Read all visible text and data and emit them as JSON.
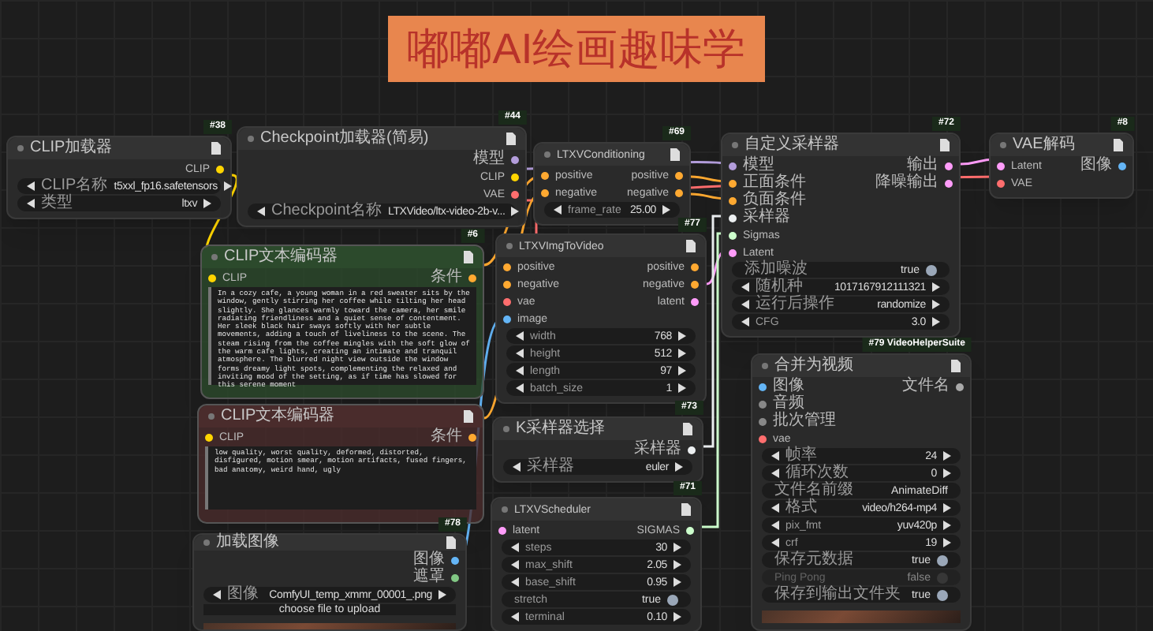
{
  "banner": {
    "title": "嘟嘟AI绘画趣味学"
  },
  "nodes": [
    {
      "badge": "#38",
      "title": "CLIP加载器",
      "outputs": [
        {
          "label": "CLIP",
          "color": "#ffd500"
        }
      ],
      "widgets": [
        {
          "kind": "combo",
          "label": "CLIP名称",
          "value": "t5xxl_fp16.safetensors"
        },
        {
          "kind": "combo",
          "label": "类型",
          "value": "ltxv"
        }
      ]
    },
    {
      "badge": "#44",
      "title": "Checkpoint加载器(简易)",
      "outputs": [
        {
          "label": "模型",
          "color": "#b39ddb"
        },
        {
          "label": "CLIP",
          "color": "#ffd500"
        },
        {
          "label": "VAE",
          "color": "#ff6e6e"
        }
      ],
      "widgets": [
        {
          "kind": "combo",
          "label": "Checkpoint名称",
          "value": "LTXVideo/ltx-video-2b-v..."
        }
      ]
    },
    {
      "badge": "#6",
      "title": "CLIP文本编码器",
      "color": "#2c4a2c",
      "inputs": [
        {
          "label": "CLIP",
          "color": "#ffd500"
        }
      ],
      "outputs": [
        {
          "label": "条件",
          "color": "#ffa931"
        }
      ],
      "widgets": [
        {
          "kind": "textarea",
          "value": "In a cozy cafe, a young woman in a red sweater sits by the window, gently stirring her coffee while tilting her head slightly. She glances warmly toward the camera, her smile radiating friendliness and a quiet sense of contentment. Her sleek black hair sways softly with her subtle movements, adding a touch of liveliness to the scene. The steam rising from the coffee mingles with the soft glow of the warm cafe lights, creating an intimate and tranquil atmosphere. The blurred night view outside the window forms dreamy light spots, complementing the relaxed and inviting mood of the setting, as if time has slowed for this serene moment"
        }
      ]
    },
    {
      "title": "CLIP文本编码器",
      "color": "#4a2c2c",
      "inputs": [
        {
          "label": "CLIP",
          "color": "#ffd500"
        }
      ],
      "outputs": [
        {
          "label": "条件",
          "color": "#ffa931"
        }
      ],
      "widgets": [
        {
          "kind": "textarea",
          "value": "low quality, worst quality, deformed, distorted, disfigured, motion smear, motion artifacts, fused fingers, bad anatomy, weird hand, ugly"
        }
      ]
    },
    {
      "badge": "#78",
      "title": "加载图像",
      "outputs": [
        {
          "label": "图像",
          "color": "#64b5f6"
        },
        {
          "label": "遮罩",
          "color": "#81c784"
        }
      ],
      "widgets": [
        {
          "kind": "combo",
          "label": "图像",
          "value": "ComfyUI_temp_xmmr_00001_.png"
        },
        {
          "kind": "button",
          "label": "choose file to upload"
        },
        {
          "kind": "image"
        }
      ]
    },
    {
      "badge": "#69",
      "title": "LTXVConditioning",
      "inputs": [
        {
          "label": "positive",
          "color": "#ffa931"
        },
        {
          "label": "negative",
          "color": "#ffa931"
        }
      ],
      "outputs": [
        {
          "label": "positive",
          "color": "#ffa931"
        },
        {
          "label": "negative",
          "color": "#ffa931"
        }
      ],
      "widgets": [
        {
          "kind": "number",
          "label": "frame_rate",
          "value": "25.00"
        }
      ]
    },
    {
      "badge": "#77",
      "title": "LTXVImgToVideo",
      "inputs": [
        {
          "label": "positive",
          "color": "#ffa931"
        },
        {
          "label": "negative",
          "color": "#ffa931"
        },
        {
          "label": "vae",
          "color": "#ff6e6e"
        },
        {
          "label": "image",
          "color": "#64b5f6"
        }
      ],
      "outputs": [
        {
          "label": "positive",
          "color": "#ffa931"
        },
        {
          "label": "negative",
          "color": "#ffa931"
        },
        {
          "label": "latent",
          "color": "#ff9cf9"
        }
      ],
      "widgets": [
        {
          "kind": "number",
          "label": "width",
          "value": "768"
        },
        {
          "kind": "number",
          "label": "height",
          "value": "512"
        },
        {
          "kind": "number",
          "label": "length",
          "value": "97"
        },
        {
          "kind": "number",
          "label": "batch_size",
          "value": "1"
        }
      ]
    },
    {
      "badge": "#73",
      "title": "K采样器选择",
      "outputs": [
        {
          "label": "采样器",
          "color": "#eceff1"
        }
      ],
      "widgets": [
        {
          "kind": "combo",
          "label": "采样器",
          "value": "euler"
        }
      ]
    },
    {
      "badge": "#71",
      "title": "LTXVScheduler",
      "inputs": [
        {
          "label": "latent",
          "color": "#ff9cf9"
        }
      ],
      "outputs": [
        {
          "label": "SIGMAS",
          "color": "#cdffcd"
        }
      ],
      "widgets": [
        {
          "kind": "number",
          "label": "steps",
          "value": "30"
        },
        {
          "kind": "number",
          "label": "max_shift",
          "value": "2.05"
        },
        {
          "kind": "number",
          "label": "base_shift",
          "value": "0.95"
        },
        {
          "kind": "toggle",
          "label": "stretch",
          "value": "true",
          "on": true
        },
        {
          "kind": "number",
          "label": "terminal",
          "value": "0.10"
        }
      ]
    },
    {
      "badge": "#72",
      "title": "自定义采样器",
      "inputs": [
        {
          "label": "模型",
          "color": "#b39ddb"
        },
        {
          "label": "正面条件",
          "color": "#ffa931"
        },
        {
          "label": "负面条件",
          "color": "#ffa931"
        },
        {
          "label": "采样器",
          "color": "#eceff1"
        },
        {
          "label": "Sigmas",
          "color": "#cdffcd"
        },
        {
          "label": "Latent",
          "color": "#ff9cf9"
        }
      ],
      "outputs": [
        {
          "label": "输出",
          "color": "#ff9cf9"
        },
        {
          "label": "降噪输出",
          "color": "#ff9cf9"
        }
      ],
      "widgets": [
        {
          "kind": "toggle",
          "label": "添加噪波",
          "value": "true",
          "on": true
        },
        {
          "kind": "number",
          "label": "随机种",
          "value": "1017167912111321"
        },
        {
          "kind": "combo",
          "label": "运行后操作",
          "value": "randomize"
        },
        {
          "kind": "number",
          "label": "CFG",
          "value": "3.0"
        }
      ]
    },
    {
      "badge": "#8",
      "title": "VAE解码",
      "inputs": [
        {
          "label": "Latent",
          "color": "#ff9cf9"
        },
        {
          "label": "VAE",
          "color": "#ff6e6e"
        }
      ],
      "outputs": [
        {
          "label": "图像",
          "color": "#64b5f6"
        }
      ]
    },
    {
      "badge": "#79 VideoHelperSuite",
      "title": "合并为视频",
      "inputs": [
        {
          "label": "图像",
          "color": "#64b5f6"
        },
        {
          "label": "音频",
          "color": "#888888"
        },
        {
          "label": "批次管理",
          "color": "#888888"
        },
        {
          "label": "vae",
          "color": "#ff6e6e"
        }
      ],
      "outputs": [
        {
          "label": "文件名",
          "color": "#aaaaaa"
        }
      ],
      "widgets": [
        {
          "kind": "number",
          "label": "帧率",
          "value": "24"
        },
        {
          "kind": "number",
          "label": "循环次数",
          "value": "0"
        },
        {
          "kind": "text",
          "label": "文件名前缀",
          "value": "AnimateDiff"
        },
        {
          "kind": "combo",
          "label": "格式",
          "value": "video/h264-mp4"
        },
        {
          "kind": "combo",
          "label": "pix_fmt",
          "value": "yuv420p"
        },
        {
          "kind": "number",
          "label": "crf",
          "value": "19"
        },
        {
          "kind": "toggle",
          "label": "保存元数据",
          "value": "true",
          "on": true
        },
        {
          "kind": "toggle",
          "label": "Ping Pong",
          "value": "false",
          "on": false
        },
        {
          "kind": "toggle",
          "label": "保存到输出文件夹",
          "value": "true",
          "on": true
        },
        {
          "kind": "image"
        }
      ]
    }
  ]
}
